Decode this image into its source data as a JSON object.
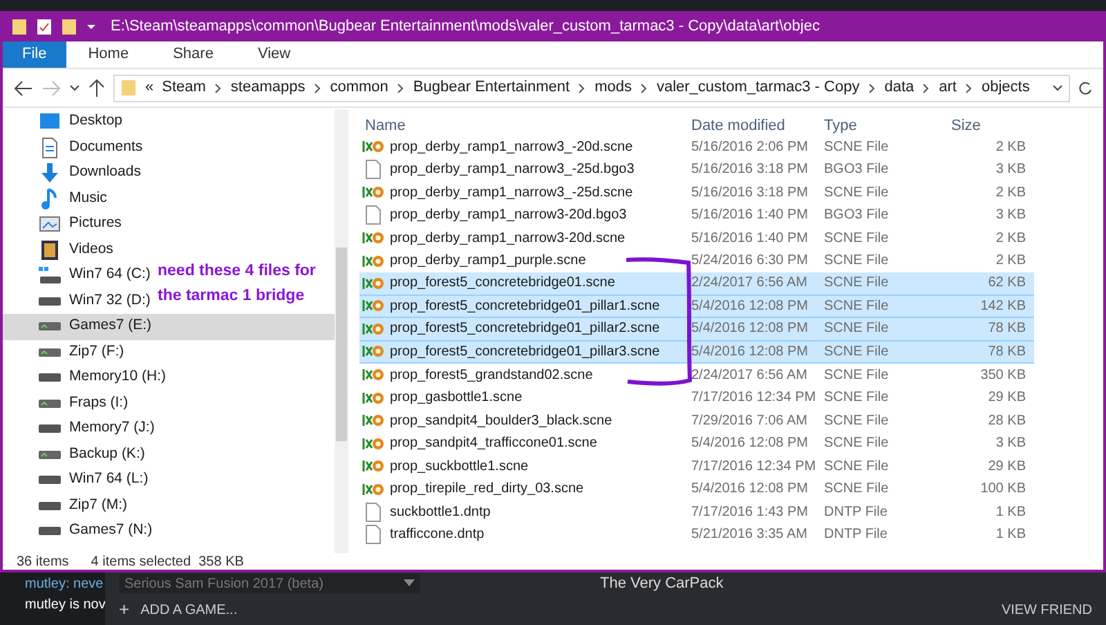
{
  "window": {
    "title": "E:\\Steam\\steamapps\\common\\Bugbear Entertainment\\mods\\valer_custom_tarmac3 - Copy\\data\\art\\objec"
  },
  "ribbon_tabs": [
    {
      "label": "File",
      "kind": "file"
    },
    {
      "label": "Home",
      "kind": "tab"
    },
    {
      "label": "Share",
      "kind": "tab"
    },
    {
      "label": "View",
      "kind": "tab"
    }
  ],
  "address_bar": {
    "overflow": "«",
    "crumbs": [
      "Steam",
      "steamapps",
      "common",
      "Bugbear Entertainment",
      "mods",
      "valer_custom_tarmac3 - Copy",
      "data",
      "art",
      "objects"
    ]
  },
  "sidebar": {
    "items": [
      {
        "label": "Desktop",
        "kind": "desktop",
        "selected": false
      },
      {
        "label": "Documents",
        "kind": "documents",
        "selected": false
      },
      {
        "label": "Downloads",
        "kind": "downloads",
        "selected": false
      },
      {
        "label": "Music",
        "kind": "music",
        "selected": false
      },
      {
        "label": "Pictures",
        "kind": "pictures",
        "selected": false
      },
      {
        "label": "Videos",
        "kind": "videos",
        "selected": false
      },
      {
        "label": "Win7 64 (C:)",
        "kind": "system",
        "selected": false
      },
      {
        "label": "Win7 32 (D:)",
        "kind": "drive",
        "selected": false
      },
      {
        "label": "Games7 (E:)",
        "kind": "shared",
        "selected": true
      },
      {
        "label": "Zip7 (F:)",
        "kind": "shared",
        "selected": false
      },
      {
        "label": "Memory10 (H:)",
        "kind": "drive",
        "selected": false
      },
      {
        "label": "Fraps (I:)",
        "kind": "shared",
        "selected": false
      },
      {
        "label": "Memory7 (J:)",
        "kind": "drive",
        "selected": false
      },
      {
        "label": "Backup (K:)",
        "kind": "shared",
        "selected": false
      },
      {
        "label": "Win7 64 (L:)",
        "kind": "drive",
        "selected": false
      },
      {
        "label": "Zip7 (M:)",
        "kind": "drive",
        "selected": false
      },
      {
        "label": "Games7 (N:)",
        "kind": "drive",
        "selected": false
      }
    ]
  },
  "annotation": {
    "text": "need these 4 files for the tarmac 1 bridge"
  },
  "table": {
    "columns": [
      "Name",
      "Date modified",
      "Type",
      "Size"
    ],
    "rows": [
      {
        "name": "prop_derby_ramp1_narrow3_-20d.scne",
        "date": "5/16/2016 2:06 PM",
        "type": "SCNE File",
        "size": "2 KB",
        "kind": "scne",
        "selected": false
      },
      {
        "name": "prop_derby_ramp1_narrow3_-25d.bgo3",
        "date": "5/16/2016 3:18 PM",
        "type": "BGO3 File",
        "size": "3 KB",
        "kind": "blank",
        "selected": false
      },
      {
        "name": "prop_derby_ramp1_narrow3_-25d.scne",
        "date": "5/16/2016 3:18 PM",
        "type": "SCNE File",
        "size": "2 KB",
        "kind": "scne",
        "selected": false
      },
      {
        "name": "prop_derby_ramp1_narrow3-20d.bgo3",
        "date": "5/16/2016 1:40 PM",
        "type": "BGO3 File",
        "size": "3 KB",
        "kind": "blank",
        "selected": false
      },
      {
        "name": "prop_derby_ramp1_narrow3-20d.scne",
        "date": "5/16/2016 1:40 PM",
        "type": "SCNE File",
        "size": "2 KB",
        "kind": "scne",
        "selected": false
      },
      {
        "name": "prop_derby_ramp1_purple.scne",
        "date": "5/24/2016 6:30 PM",
        "type": "SCNE File",
        "size": "2 KB",
        "kind": "scne",
        "selected": false
      },
      {
        "name": "prop_forest5_concretebridge01.scne",
        "date": "2/24/2017 6:56 AM",
        "type": "SCNE File",
        "size": "62 KB",
        "kind": "scne",
        "selected": true
      },
      {
        "name": "prop_forest5_concretebridge01_pillar1.scne",
        "date": "5/4/2016 12:08 PM",
        "type": "SCNE File",
        "size": "142 KB",
        "kind": "scne",
        "selected": true
      },
      {
        "name": "prop_forest5_concretebridge01_pillar2.scne",
        "date": "5/4/2016 12:08 PM",
        "type": "SCNE File",
        "size": "78 KB",
        "kind": "scne",
        "selected": true
      },
      {
        "name": "prop_forest5_concretebridge01_pillar3.scne",
        "date": "5/4/2016 12:08 PM",
        "type": "SCNE File",
        "size": "78 KB",
        "kind": "scne",
        "selected": true
      },
      {
        "name": "prop_forest5_grandstand02.scne",
        "date": "2/24/2017 6:56 AM",
        "type": "SCNE File",
        "size": "350 KB",
        "kind": "scne",
        "selected": false
      },
      {
        "name": "prop_gasbottle1.scne",
        "date": "7/17/2016 12:34 PM",
        "type": "SCNE File",
        "size": "29 KB",
        "kind": "scne",
        "selected": false
      },
      {
        "name": "prop_sandpit4_boulder3_black.scne",
        "date": "7/29/2016 7:06 AM",
        "type": "SCNE File",
        "size": "28 KB",
        "kind": "scne",
        "selected": false
      },
      {
        "name": "prop_sandpit4_trafficcone01.scne",
        "date": "5/4/2016 12:08 PM",
        "type": "SCNE File",
        "size": "3 KB",
        "kind": "scne",
        "selected": false
      },
      {
        "name": "prop_suckbottle1.scne",
        "date": "7/17/2016 12:34 PM",
        "type": "SCNE File",
        "size": "29 KB",
        "kind": "scne",
        "selected": false
      },
      {
        "name": "prop_tirepile_red_dirty_03.scne",
        "date": "5/4/2016 12:08 PM",
        "type": "SCNE File",
        "size": "100 KB",
        "kind": "scne",
        "selected": false
      },
      {
        "name": "suckbottle1.dntp",
        "date": "7/17/2016 1:43 PM",
        "type": "DNTP File",
        "size": "1 KB",
        "kind": "blank",
        "selected": false
      },
      {
        "name": "trafficcone.dntp",
        "date": "5/21/2016 3:35 AM",
        "type": "DNTP File",
        "size": "1 KB",
        "kind": "blank",
        "selected": false
      }
    ]
  },
  "status_bar": {
    "count": "36 items",
    "selection": "4 items selected  358 KB"
  },
  "steam": {
    "chat": [
      "mutley: neve",
      "mutley is nov"
    ],
    "game_select": "Serious Sam Fusion 2017 (beta)",
    "title": "The Very CarPack",
    "add_game": "ADD A GAME...",
    "add_icon": "+",
    "view_friends": "VIEW FRIEND"
  }
}
